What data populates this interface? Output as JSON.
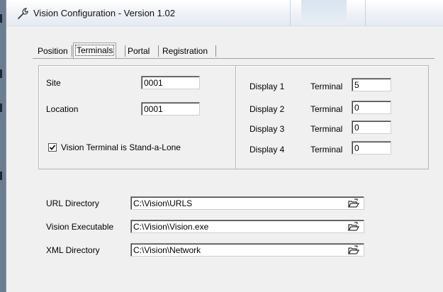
{
  "window": {
    "title": "Vision Configuration - Version 1.02"
  },
  "tabs": [
    {
      "label": "Position",
      "active": false
    },
    {
      "label": "Terminals",
      "active": true
    },
    {
      "label": "Portal",
      "active": false
    },
    {
      "label": "Registration",
      "active": false
    }
  ],
  "site": {
    "label": "Site",
    "value": "0001"
  },
  "location": {
    "label": "Location",
    "value": "0001"
  },
  "standalone": {
    "label": "Vision Terminal is Stand-a-Lone",
    "checked": true
  },
  "displays": [
    {
      "label": "Display 1",
      "terminal_label": "Terminal",
      "value": "5"
    },
    {
      "label": "Display 2",
      "terminal_label": "Terminal",
      "value": "0"
    },
    {
      "label": "Display 3",
      "terminal_label": "Terminal",
      "value": "0"
    },
    {
      "label": "Display 4",
      "terminal_label": "Terminal",
      "value": "0"
    }
  ],
  "paths": [
    {
      "label": "URL Directory",
      "value": "C:\\Vision\\URLS"
    },
    {
      "label": "Vision Executable",
      "value": "C:\\Vision\\Vision.exe"
    },
    {
      "label": "XML Directory",
      "value": "C:\\Vision\\Network"
    }
  ],
  "icons": {
    "app": "wrench-icon",
    "browse": "open-folder-icon"
  }
}
